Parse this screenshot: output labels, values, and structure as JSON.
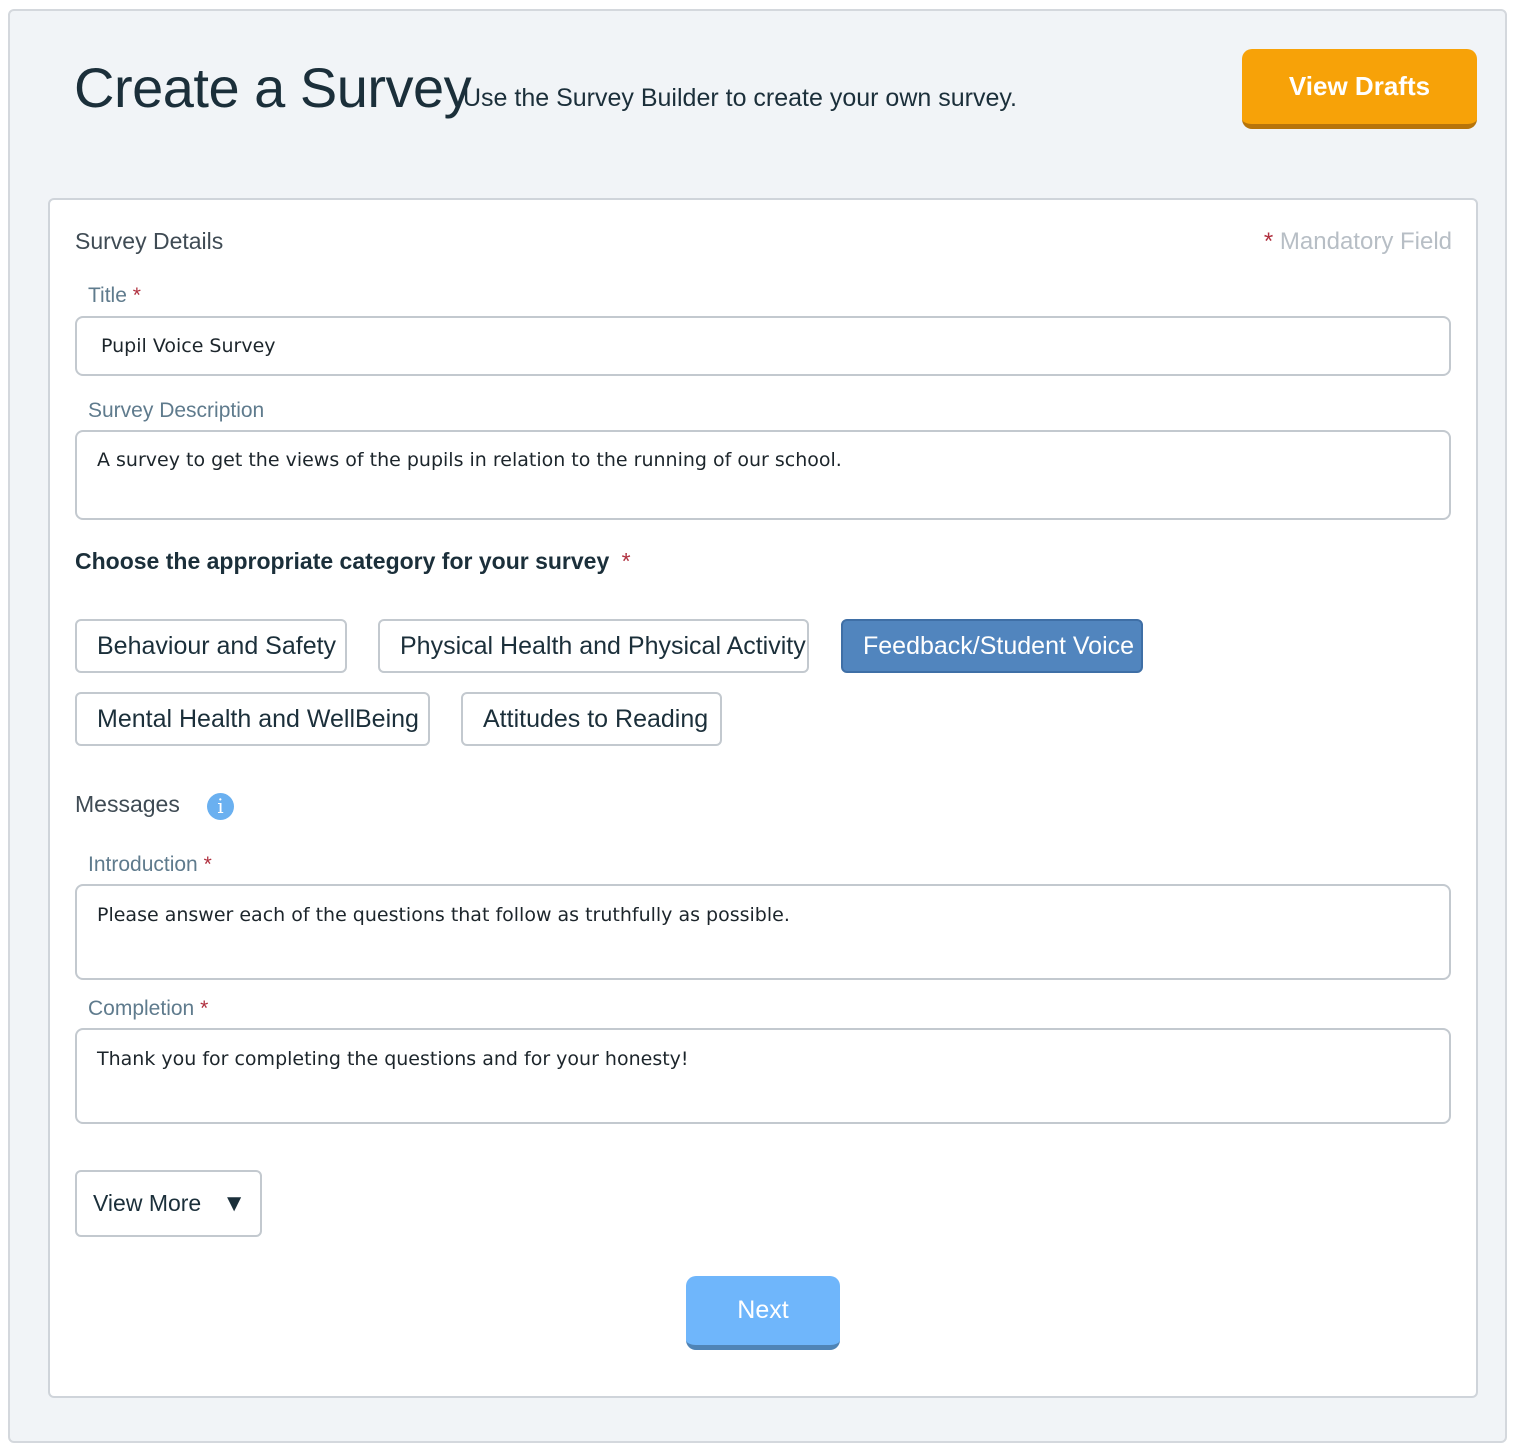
{
  "header": {
    "title": "Create a Survey",
    "subtitle": "Use the Survey Builder to create your own survey.",
    "drafts_button": "View Drafts"
  },
  "form": {
    "section_title": "Survey Details",
    "mandatory_star": "*",
    "mandatory_text": "Mandatory Field",
    "title_label": "Title",
    "title_value": "Pupil Voice Survey",
    "description_label": "Survey Description",
    "description_value": "A survey to get the views of the pupils in relation to the running of our school.",
    "category_heading": "Choose the appropriate category for your survey",
    "categories": [
      {
        "label": "Behaviour and Safety",
        "selected": false
      },
      {
        "label": "Physical Health and Physical Activity",
        "selected": false
      },
      {
        "label": "Feedback/Student Voice",
        "selected": true
      },
      {
        "label": "Mental Health and WellBeing",
        "selected": false
      },
      {
        "label": "Attitudes to Reading",
        "selected": false
      }
    ],
    "messages_label": "Messages",
    "info_icon": "info-icon",
    "introduction_label": "Introduction",
    "introduction_value": "Please answer each of the questions that follow as truthfully as possible.",
    "completion_label": "Completion",
    "completion_value": "Thank you for completing the questions and for your honesty!",
    "view_more_label": "View More",
    "next_label": "Next"
  },
  "colors": {
    "page_bg": "#f1f4f7",
    "accent_orange": "#f7a208",
    "selected_category": "#5185be",
    "next_button": "#6fb6fb",
    "required_star": "#b0303f"
  }
}
